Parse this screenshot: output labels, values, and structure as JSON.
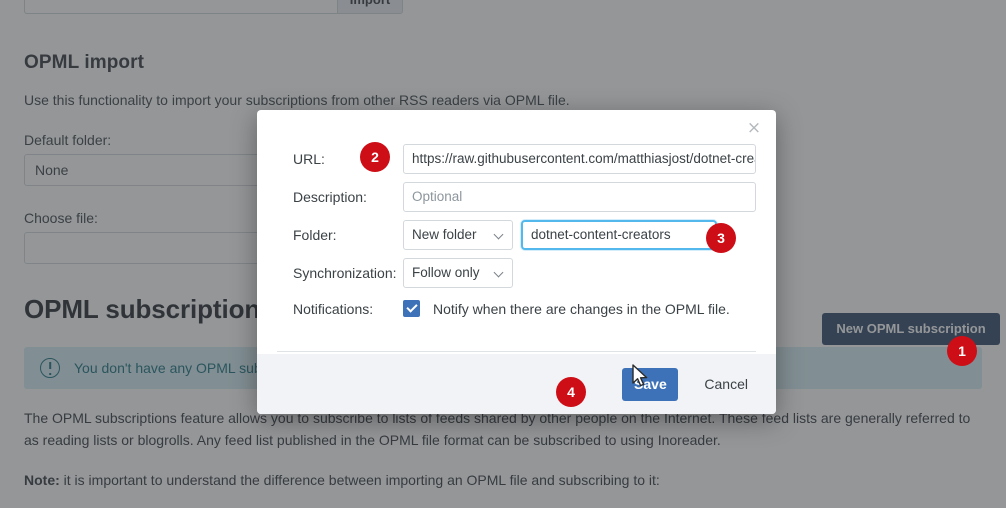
{
  "background": {
    "import_row": {
      "input_value": "",
      "import_button_label": "Import"
    },
    "opml_import": {
      "heading": "OPML import",
      "description": "Use this functionality to import your subscriptions from other RSS readers via OPML file.",
      "default_folder_label": "Default folder:",
      "default_folder_value": "None",
      "choose_file_label": "Choose file:",
      "choose_file_value": ""
    },
    "opml_subscriptions": {
      "heading": "OPML subscriptions",
      "new_subscription_button": "New OPML subscription",
      "empty_banner": "You don't have any OPML subscriptions yet.",
      "paragraph": "The OPML subscriptions feature allows you to subscribe to lists of feeds shared by other people on the Internet. These feed lists are generally referred to as reading lists or blogrolls. Any feed list published in the OPML file format can be subscribed to using Inoreader.",
      "note_prefix": "Note:",
      "note_text": " it is important to understand the difference between importing an OPML file and subscribing to it:"
    }
  },
  "modal": {
    "close_label": "×",
    "fields": {
      "url_label": "URL:",
      "url_value": "https://raw.githubusercontent.com/matthiasjost/dotnet-crea",
      "description_label": "Description:",
      "description_placeholder": "Optional",
      "folder_label": "Folder:",
      "folder_select_value": "New folder",
      "folder_name_value": "dotnet-content-creators",
      "sync_label": "Synchronization:",
      "sync_select_value": "Follow only",
      "notifications_label": "Notifications:",
      "notifications_checkbox_checked": true,
      "notifications_text": "Notify when there are changes in the OPML file."
    },
    "footer": {
      "save_label": "Save",
      "cancel_label": "Cancel"
    }
  },
  "annotations": {
    "badge1": "1",
    "badge2": "2",
    "badge3": "3",
    "badge4": "4"
  },
  "colors": {
    "badge_red": "#ce0e16",
    "primary_blue": "#3d72b8",
    "dark_navy": "#2c4668",
    "focus_blue": "#53b9ec",
    "info_teal": "#17707f"
  }
}
